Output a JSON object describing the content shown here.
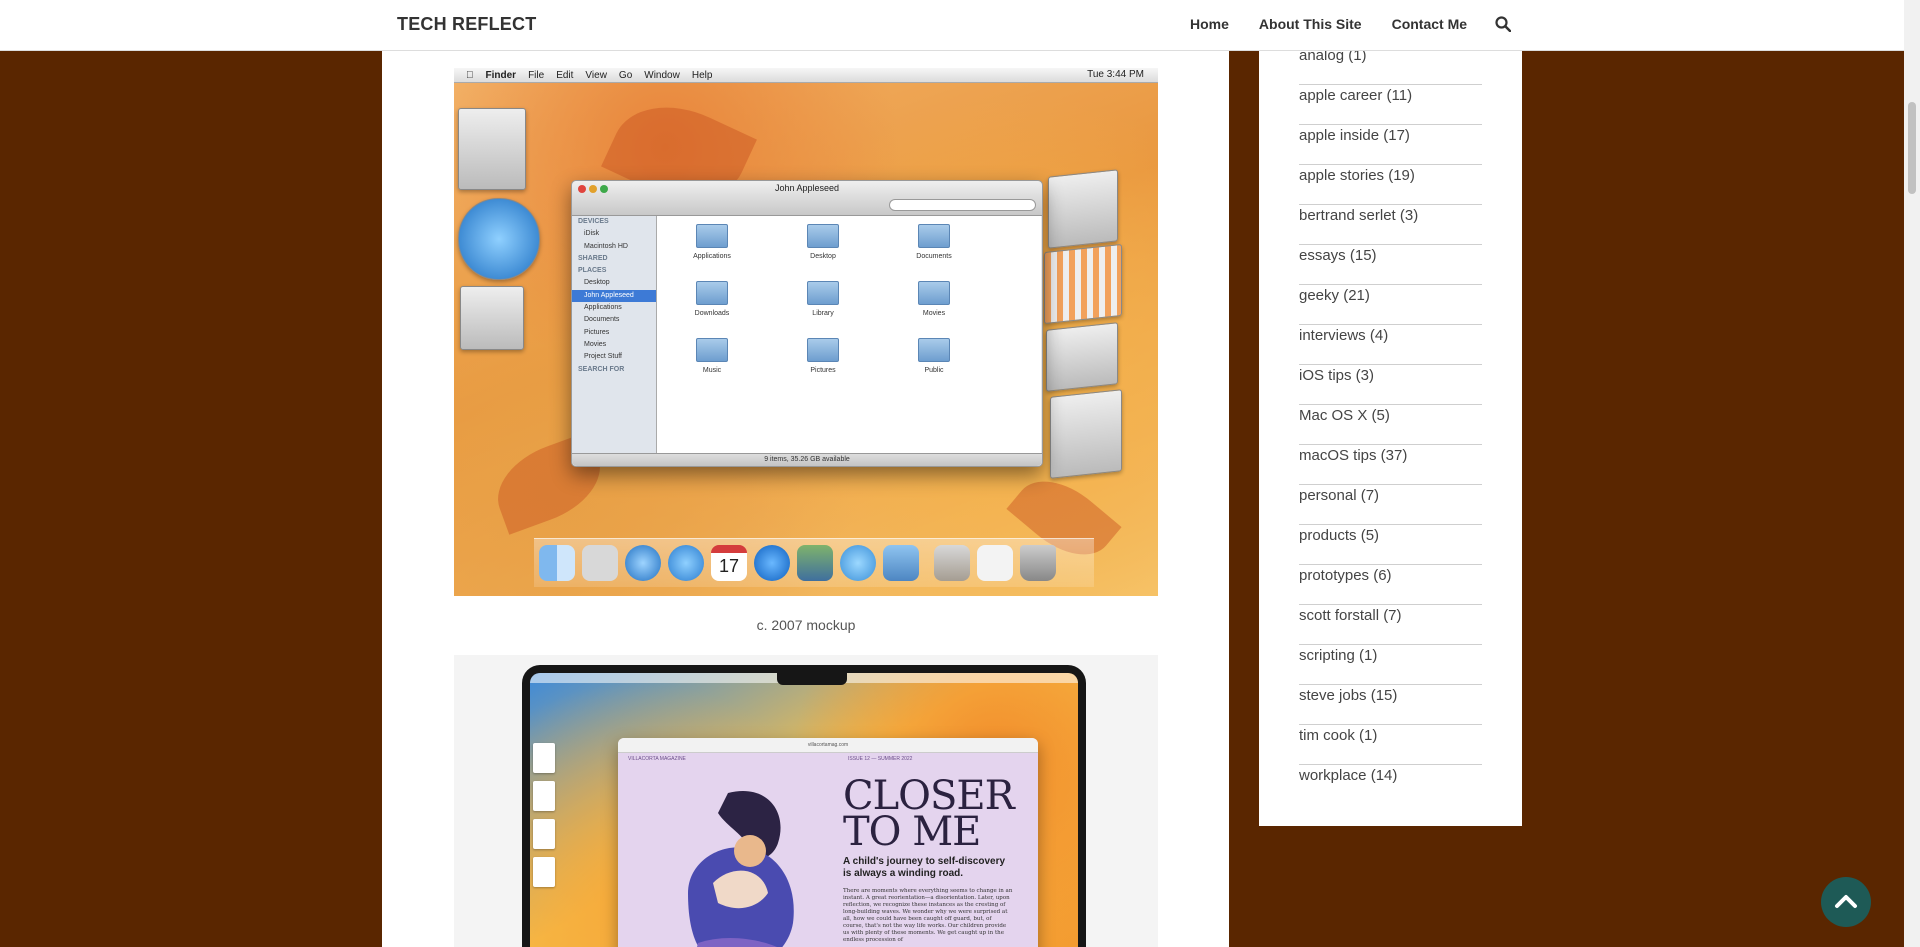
{
  "header": {
    "site_title": "TECH REFLECT",
    "nav": [
      "Home",
      "About This Site",
      "Contact Me"
    ],
    "search_icon": "search-icon"
  },
  "article": {
    "image1": {
      "menubar": [
        "Finder",
        "File",
        "Edit",
        "View",
        "Go",
        "Window",
        "Help"
      ],
      "clock": "Tue 3:44 PM",
      "finder_title": "John Appleseed",
      "sidebar": {
        "devices_header": "DEVICES",
        "devices": [
          "iDisk",
          "Macintosh HD"
        ],
        "shared_header": "SHARED",
        "places_header": "PLACES",
        "places": [
          "Desktop",
          "John Appleseed",
          "Applications",
          "Documents",
          "Pictures",
          "Movies",
          "Project Stuff"
        ],
        "search_header": "SEARCH FOR"
      },
      "folders": [
        "Applications",
        "Desktop",
        "Documents",
        "Downloads",
        "Library",
        "Movies",
        "Music",
        "Pictures",
        "Public"
      ],
      "status": "9 items, 35.26 GB available",
      "dock_date": "17"
    },
    "caption1": "c. 2007 mockup",
    "image2": {
      "magazine_header_left": "VILLACORTA MAGAZINE",
      "magazine_header_right": "ISSUE 12 — SUMMER 2022",
      "url": "villacortamag.com",
      "headline_line1": "CLOSER",
      "headline_line2": "TO ME",
      "subhead": "A child's journey to self-discovery is always a winding road.",
      "body": "There are moments where everything seems to change in an instant. A great reorientation—a disorientation. Later, upon reflection, we recognize these instances as the cresting of long-building waves. We wonder why we were surprised at all, how we could have been caught off guard, but, of course, that's not the way life works. Our children provide us with plenty of these moments. We get caught up in the endless procession of"
    }
  },
  "sidebar": {
    "categories": [
      "analog (1)",
      "apple career (11)",
      "apple inside (17)",
      "apple stories (19)",
      "bertrand serlet (3)",
      "essays (15)",
      "geeky (21)",
      "interviews (4)",
      "iOS tips (3)",
      "Mac OS X (5)",
      "macOS tips (37)",
      "personal (7)",
      "products (5)",
      "prototypes (6)",
      "scott forstall (7)",
      "scripting (1)",
      "steve jobs (15)",
      "tim cook (1)",
      "workplace (14)"
    ]
  },
  "colors": {
    "page_background": "#5a2600",
    "scroll_top_button": "#1e5a56"
  }
}
